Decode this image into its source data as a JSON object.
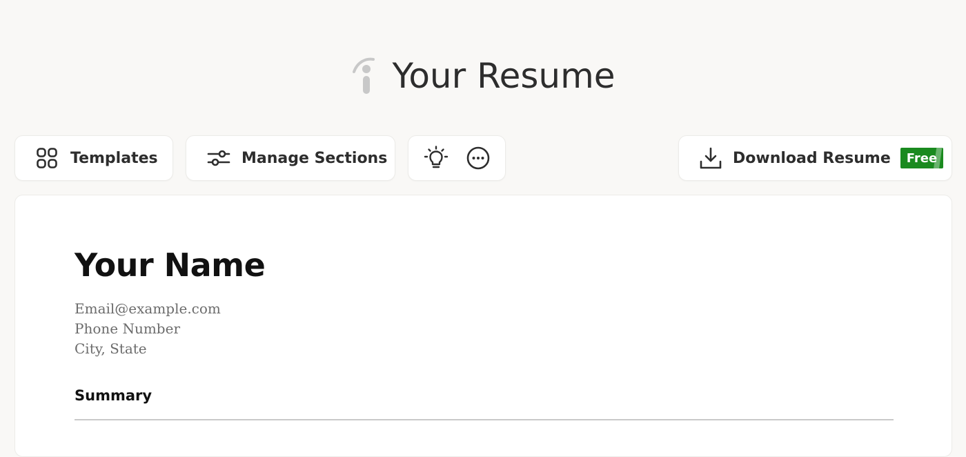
{
  "app": {
    "title": "Your Resume",
    "logo_icon": "indeed-logo-icon"
  },
  "toolbar": {
    "templates": {
      "label": "Templates",
      "icon": "grid-icon"
    },
    "manage_sections": {
      "label": "Manage Sections",
      "icon": "sliders-icon"
    },
    "tips": {
      "icon": "lightbulb-icon"
    },
    "more": {
      "icon": "more-options-icon"
    },
    "download": {
      "label": "Download Resume",
      "icon": "download-icon",
      "badge": "Free"
    }
  },
  "resume": {
    "name": "Your Name",
    "email": "Email@example.com",
    "phone": "Phone Number",
    "location": "City, State",
    "sections": [
      {
        "title": "Summary"
      }
    ]
  },
  "colors": {
    "background": "#f9f8f6",
    "card": "#ffffff",
    "text": "#2d2d2d",
    "muted_text": "#6b6b6b",
    "badge_green": "#1a8a1f"
  }
}
